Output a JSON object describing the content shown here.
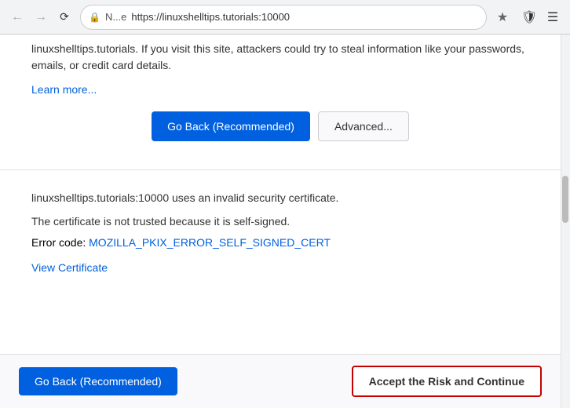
{
  "browser": {
    "back_title": "Back",
    "forward_title": "Forward",
    "reload_title": "Reload",
    "lock_label": "N...e",
    "url": "https://linuxshelltips.tutorials:10000",
    "star_title": "Bookmark this page",
    "shield_title": "Shield",
    "menu_title": "Menu"
  },
  "upper": {
    "warning_text": "linuxshelltips.tutorials. If you visit this site, attackers could try to steal information like your passwords, emails, or credit card details.",
    "learn_more": "Learn more...",
    "go_back_btn": "Go Back (Recommended)",
    "advanced_btn": "Advanced..."
  },
  "advanced": {
    "line1": "linuxshelltips.tutorials:10000 uses an invalid security certificate.",
    "line2": "The certificate is not trusted because it is self-signed.",
    "error_label": "Error code: ",
    "error_code": "MOZILLA_PKIX_ERROR_SELF_SIGNED_CERT",
    "view_cert": "View Certificate",
    "go_back_btn": "Go Back (Recommended)",
    "accept_risk_btn": "Accept the Risk and Continue"
  }
}
